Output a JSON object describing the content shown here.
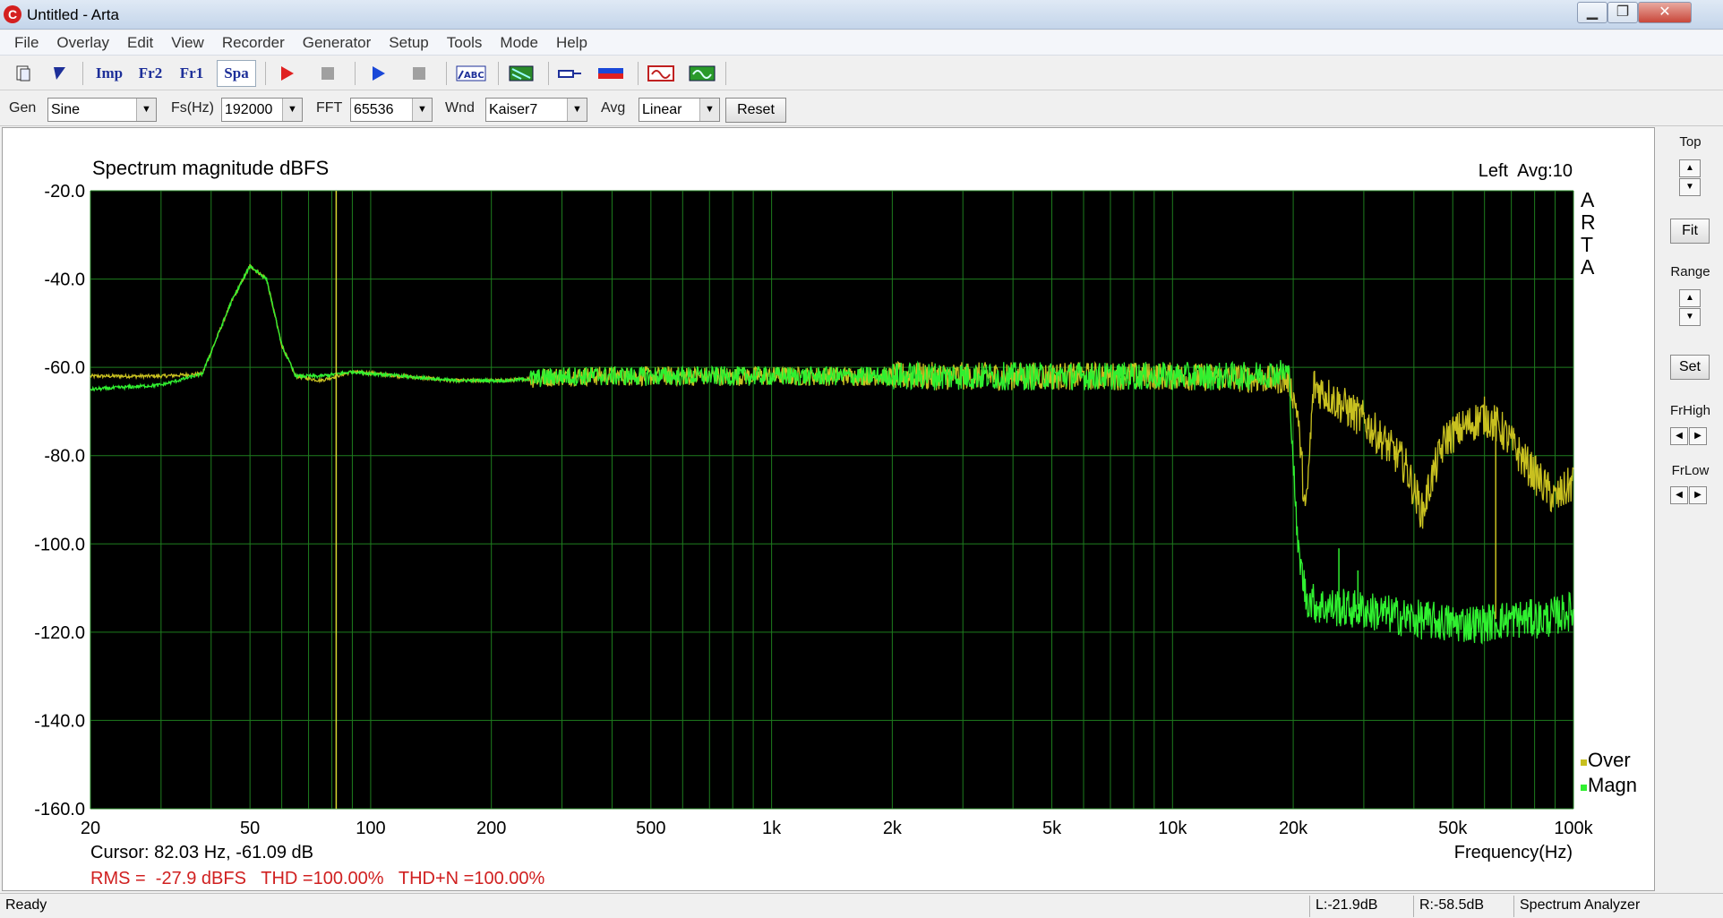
{
  "window": {
    "title": "Untitled - Arta",
    "app_icon": "arta-app-icon",
    "min_glyph": "▁",
    "max_glyph": "❐",
    "close_glyph": "✕"
  },
  "menu": [
    "File",
    "Overlay",
    "Edit",
    "View",
    "Recorder",
    "Generator",
    "Setup",
    "Tools",
    "Mode",
    "Help"
  ],
  "toolbar": {
    "imp": "Imp",
    "fr2": "Fr2",
    "fr1": "Fr1",
    "spa": "Spa"
  },
  "controls": {
    "gen_label": "Gen",
    "gen_value": "Sine",
    "fs_label": "Fs(Hz)",
    "fs_value": "192000",
    "fft_label": "FFT",
    "fft_value": "65536",
    "wnd_label": "Wnd",
    "wnd_value": "Kaiser7",
    "avg_label": "Avg",
    "avg_value": "Linear",
    "reset_label": "Reset"
  },
  "side": {
    "top_label": "Top",
    "fit_label": "Fit",
    "range_label": "Range",
    "set_label": "Set",
    "frhigh_label": "FrHigh",
    "frlow_label": "FrLow"
  },
  "status": {
    "ready": "Ready",
    "left_level": "L:-21.9dB",
    "right_level": "R:-58.5dB",
    "mode": "Spectrum Analyzer"
  },
  "chart_data": {
    "type": "line",
    "title": "Spectrum magnitude dBFS",
    "channel_info": "Left  Avg:10",
    "watermark": [
      "A",
      "R",
      "T",
      "A"
    ],
    "xlabel": "Frequency(Hz)",
    "ylabel": "",
    "x_scale": "log",
    "xlim": [
      20,
      100000
    ],
    "ylim": [
      -160,
      -20
    ],
    "x_ticks": [
      20,
      50,
      100,
      200,
      500,
      1000,
      2000,
      5000,
      10000,
      20000,
      50000,
      100000
    ],
    "x_tick_labels": [
      "20",
      "50",
      "100",
      "200",
      "500",
      "1k",
      "2k",
      "5k",
      "10k",
      "20k",
      "50k",
      "100k"
    ],
    "y_ticks": [
      -20,
      -40,
      -60,
      -80,
      -100,
      -120,
      -140,
      -160
    ],
    "y_tick_labels": [
      "-20.0",
      "-40.0",
      "-60.0",
      "-80.0",
      "-100.0",
      "-120.0",
      "-140.0",
      "-160.0"
    ],
    "grid": true,
    "background": "#000000",
    "grid_color": "#1e7d1e",
    "cursor": {
      "freq_hz": 82.03,
      "level_db": -61.09,
      "color": "#d8d830"
    },
    "cursor_text": "Cursor: 82.03 Hz, -61.09 dB",
    "measurements": "RMS =  -27.9 dBFS   THD =100.00%   THD+N =100.00%",
    "legend_position": "bottom-right",
    "series": [
      {
        "name": "Over",
        "color": "#c8c020",
        "points": [
          [
            20,
            -62
          ],
          [
            30,
            -62
          ],
          [
            38,
            -61.5
          ],
          [
            45,
            -45
          ],
          [
            50,
            -37
          ],
          [
            55,
            -40
          ],
          [
            60,
            -55
          ],
          [
            65,
            -62
          ],
          [
            75,
            -63
          ],
          [
            90,
            -61
          ],
          [
            120,
            -62
          ],
          [
            160,
            -63
          ],
          [
            220,
            -63
          ],
          [
            300,
            -62
          ],
          [
            500,
            -62
          ],
          [
            1000,
            -62
          ],
          [
            2000,
            -62
          ],
          [
            5000,
            -62
          ],
          [
            10000,
            -62
          ],
          [
            15000,
            -62.5
          ],
          [
            19500,
            -63
          ],
          [
            20500,
            -70
          ],
          [
            21500,
            -94
          ],
          [
            22500,
            -64
          ],
          [
            25000,
            -67
          ],
          [
            30000,
            -72
          ],
          [
            38000,
            -82
          ],
          [
            42000,
            -93
          ],
          [
            44000,
            -86
          ],
          [
            48000,
            -76
          ],
          [
            60000,
            -71
          ],
          [
            66000,
            -74
          ],
          [
            75000,
            -81
          ],
          [
            90000,
            -90
          ],
          [
            100000,
            -86
          ]
        ]
      },
      {
        "name": "Magn",
        "color": "#30f030",
        "points": [
          [
            20,
            -65
          ],
          [
            30,
            -64
          ],
          [
            38,
            -61.5
          ],
          [
            45,
            -45
          ],
          [
            50,
            -37
          ],
          [
            55,
            -40
          ],
          [
            60,
            -55
          ],
          [
            65,
            -62
          ],
          [
            75,
            -62
          ],
          [
            90,
            -61
          ],
          [
            120,
            -62
          ],
          [
            160,
            -63
          ],
          [
            220,
            -63
          ],
          [
            300,
            -62
          ],
          [
            500,
            -62
          ],
          [
            1000,
            -62
          ],
          [
            2000,
            -62
          ],
          [
            5000,
            -62
          ],
          [
            10000,
            -62
          ],
          [
            15000,
            -62
          ],
          [
            19500,
            -61
          ],
          [
            20500,
            -100
          ],
          [
            21500,
            -112
          ],
          [
            23000,
            -114
          ],
          [
            30000,
            -115
          ],
          [
            40000,
            -117
          ],
          [
            50000,
            -118
          ],
          [
            60000,
            -118
          ],
          [
            70000,
            -117
          ],
          [
            85000,
            -117
          ],
          [
            100000,
            -115
          ]
        ]
      }
    ],
    "spurs": [
      {
        "freq_hz": 26000,
        "level_db": -101,
        "series": "Magn"
      },
      {
        "freq_hz": 29000,
        "level_db": -106,
        "series": "Magn"
      },
      {
        "freq_hz": 64000,
        "level_db": -117,
        "series": "Over"
      }
    ]
  }
}
